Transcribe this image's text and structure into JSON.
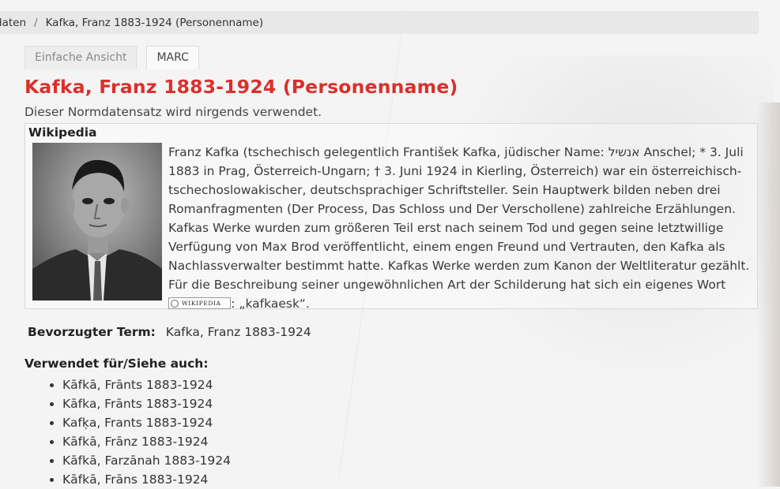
{
  "breadcrumb": {
    "parent": "daten",
    "current": "Kafka, Franz 1883-1924 (Personenname)"
  },
  "tabs": [
    {
      "label": "Einfache Ansicht"
    },
    {
      "label": "MARC"
    }
  ],
  "record": {
    "title": "Kafka, Franz 1883-1924 (Personenname)",
    "usage": "Dieser Normdatensatz wird nirgends verwendet."
  },
  "wikipedia": {
    "heading": "Wikipedia",
    "text": "Franz Kafka (tschechisch gelegentlich František Kafka, jüdischer Name: אנשיל Anschel; * 3. Juli 1883 in Prag, Österreich-Ungarn; † 3. Juni 1924 in Kierling, Österreich) war ein österreichisch-tschechoslowakischer, deutschsprachiger Schriftsteller. Sein Hauptwerk bilden neben drei Romanfragmenten (Der Process, Das Schloss und Der Verschollene) zahlreiche Erzählungen. Kafkas Werke wurden zum größeren Teil erst nach seinem Tod und gegen seine letztwillige Verfügung von Max Brod veröffentlicht, einem engen Freund und Vertrauten, den Kafka als Nachlassverwalter bestimmt hatte. Kafkas Werke werden zum Kanon der Weltliteratur gezählt. Für die Beschreibung seiner ungewöhnlichen Art der Schilderung hat sich ein eigenes Wort entwickelt: „kafkaesk“.",
    "logo_text": "WIKIPEDIA"
  },
  "preferred": {
    "label": "Bevorzugter Term:",
    "value": "Kafka, Franz 1883-1924"
  },
  "see_also": {
    "label": "Verwendet für/Siehe auch:",
    "items": [
      "Kāfkā, Frānts 1883-1924",
      "Kāfka, Frānts 1883-1924",
      "Kafḳa, Frants 1883-1924",
      "Kāfkā, Frānz 1883-1924",
      "Kāfkā, Farzānah 1883-1924",
      "Kāfkā, Frāns 1883-1924"
    ]
  },
  "colors": {
    "title": "#d9302c",
    "breadcrumb_bg": "#e8e8e8"
  }
}
